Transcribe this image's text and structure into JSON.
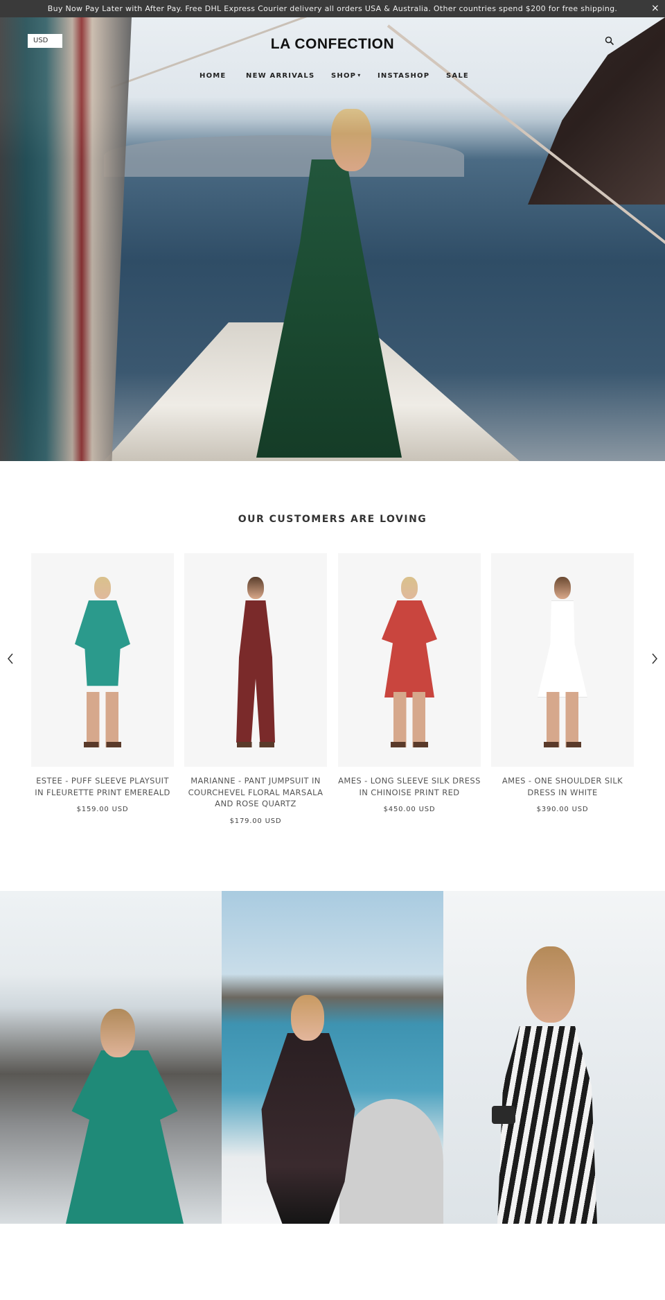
{
  "announcement": {
    "text": "Buy Now Pay Later with After Pay. Free DHL Express Courier delivery all orders USA & Australia. Other countries spend $200 for free shipping.",
    "close_label": "×"
  },
  "header": {
    "currency": "USD",
    "logo": "LA CONFECTION",
    "search_icon": "search-icon"
  },
  "nav": {
    "items": [
      {
        "label": "HOME"
      },
      {
        "label": "NEW ARRIVALS"
      },
      {
        "label": "SHOP",
        "has_dropdown": true
      },
      {
        "label": "INSTASHOP"
      },
      {
        "label": "SALE"
      }
    ]
  },
  "featured": {
    "title": "OUR CUSTOMERS ARE LOVING",
    "prev_icon": "chevron-left-icon",
    "next_icon": "chevron-right-icon",
    "products": [
      {
        "name": "ESTEE - PUFF SLEEVE PLAYSUIT IN FLEURETTE PRINT EMEREALD",
        "price": "$159.00 USD",
        "color": "#2b9a8c"
      },
      {
        "name": "MARIANNE - PANT JUMPSUIT IN COURCHEVEL FLORAL MARSALA AND ROSE QUARTZ",
        "price": "$179.00 USD",
        "color": "#7a2a2a"
      },
      {
        "name": "AMES - LONG SLEEVE SILK DRESS IN CHINOISE PRINT RED",
        "price": "$450.00 USD",
        "color": "#c9453e"
      },
      {
        "name": "AMES - ONE SHOULDER SILK DRESS IN WHITE",
        "price": "$390.00 USD",
        "color": "#f2f2f2"
      }
    ]
  },
  "colors": {
    "announcement_bg": "#3a3a3a",
    "text": "#333333",
    "product_bg": "#f6f6f6"
  }
}
